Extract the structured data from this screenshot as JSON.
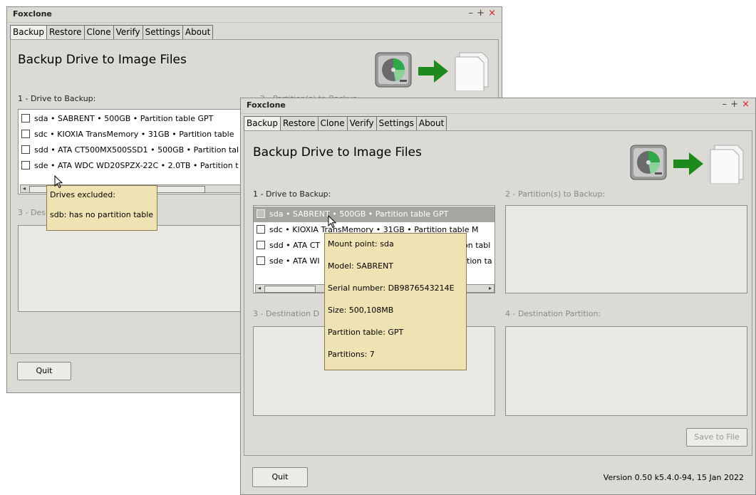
{
  "app": {
    "title": "Foxclone",
    "controls": {
      "minimize": "–",
      "maximize": "+",
      "close": "×"
    }
  },
  "tabs": [
    {
      "label": "Backup",
      "active": true
    },
    {
      "label": "Restore",
      "active": false
    },
    {
      "label": "Clone",
      "active": false
    },
    {
      "label": "Verify",
      "active": false
    },
    {
      "label": "Settings",
      "active": false
    },
    {
      "label": "About",
      "active": false
    }
  ],
  "page": {
    "heading": "Backup Drive to Image Files",
    "section1": "1 - Drive to Backup:",
    "section2": "2 - Partition(s) to Backup:",
    "section2_partial": "2 - Partition(s) to Backup:",
    "section3": "3 - Destination Drive:",
    "section3_partial_w1": "3 - Des",
    "section3_partial_w2": "3 - Destination D",
    "section4": "4 - Destination Partition:"
  },
  "back_window": {
    "drives": [
      "sda • SABRENT  • 500GB • Partition table GPT",
      "sdc • KIOXIA TransMemory • 31GB • Partition table",
      "sdd • ATA CT500MX500SSD1 • 500GB • Partition tal",
      "sde • ATA WDC WD20SPZX-22C • 2.0TB • Partition t"
    ],
    "tooltip": {
      "title": "Drives excluded:",
      "body": "sdb: has no partition table"
    },
    "quit_label": "Quit"
  },
  "front_window": {
    "drives": [
      {
        "text": "sda • SABRENT  • 500GB • Partition table GPT",
        "selected": true
      },
      {
        "text": "sdc • KIOXIA TransMemory • 31GB • Partition table M",
        "selected": false
      },
      {
        "text": "sdd • ATA CT",
        "tail": "on tabl",
        "selected": false
      },
      {
        "text": "sde • ATA WI",
        "tail": "ition ta",
        "selected": false
      }
    ],
    "tooltip": {
      "mount_point": "Mount point:  sda",
      "model": "Model:  SABRENT",
      "serial": "Serial number:  DB9876543214E",
      "size": "Size:  500,108MB",
      "partition_table": "Partition table:  GPT",
      "partitions": "Partitions:  7"
    },
    "save_label": "Save to File",
    "quit_label": "Quit",
    "version": "Version 0.50 k5.4.0-94, 15 Jan 2022"
  },
  "icons": [
    "hard-drive-icon",
    "arrow-right-icon",
    "image-files-icon",
    "mouse-cursor-icon"
  ],
  "colors": {
    "arrow": "#1e8a1e",
    "tooltip_bg": "#efe2b3",
    "close": "#d42020",
    "selected_row": "#a6a5a0"
  }
}
